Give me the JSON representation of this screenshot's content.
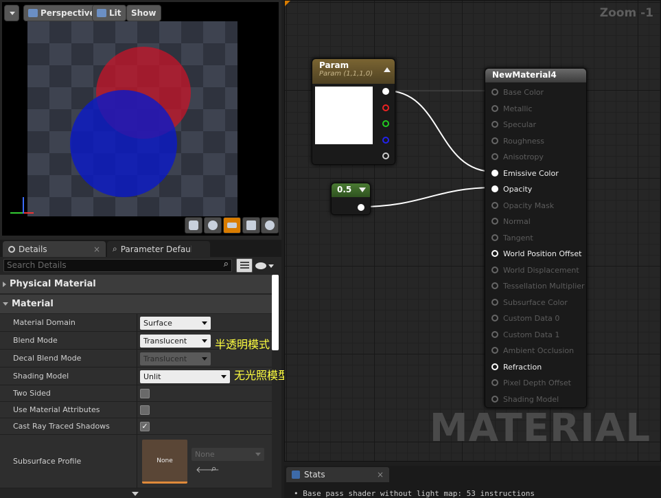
{
  "viewport": {
    "perspective": "Perspective",
    "lit": "Lit",
    "show": "Show"
  },
  "tabs": {
    "details": "Details",
    "param_defaults": "Parameter Defaults"
  },
  "search": {
    "placeholder": "Search Details"
  },
  "categories": {
    "physical": "Physical Material",
    "material": "Material"
  },
  "props": {
    "domain_label": "Material Domain",
    "domain_value": "Surface",
    "blend_label": "Blend Mode",
    "blend_value": "Translucent",
    "decal_label": "Decal Blend Mode",
    "decal_value": "Translucent",
    "shading_label": "Shading Model",
    "shading_value": "Unlit",
    "twosided_label": "Two Sided",
    "usemat_label": "Use Material Attributes",
    "castray_label": "Cast Ray Traced Shadows",
    "subsurface_label": "Subsurface Profile",
    "subsurface_thumb": "None",
    "subsurface_value": "None"
  },
  "annotations": {
    "blend_note": "半透明模式",
    "shading_note": "无光照模型"
  },
  "graph": {
    "zoom": "Zoom -1",
    "watermark": "MATERIAL",
    "param_node": {
      "title": "Param",
      "subtitle": "Param (1,1,1,0)"
    },
    "const_node": {
      "value": "0.5"
    },
    "material_node": {
      "title": "NewMaterial4",
      "pins": [
        "Base Color",
        "Metallic",
        "Specular",
        "Roughness",
        "Anisotropy",
        "Emissive Color",
        "Opacity",
        "Opacity Mask",
        "Normal",
        "Tangent",
        "World Position Offset",
        "World Displacement",
        "Tessellation Multiplier",
        "Subsurface Color",
        "Custom Data 0",
        "Custom Data 1",
        "Ambient Occlusion",
        "Refraction",
        "Pixel Depth Offset",
        "Shading Model"
      ]
    }
  },
  "stats": {
    "tab": "Stats",
    "line": "Base pass shader without light map: 53 instructions"
  },
  "colors": {
    "accent_orange": "#d97c00",
    "param_header": "#6e5a2c",
    "const_header": "#3e6b2a",
    "material_header": "#5a5a5a"
  }
}
